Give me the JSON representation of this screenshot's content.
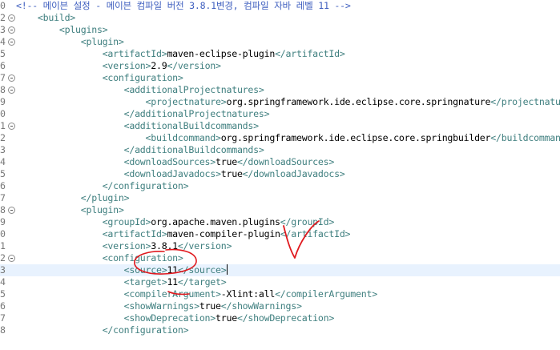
{
  "editor": {
    "lines": [
      {
        "num": "0",
        "fold": false,
        "indent": "",
        "parts": [
          {
            "c": "cmt",
            "t": "<!-- 메이븐 설정 - 메이븐 컴파일 버전 3.8.1변경, 컴파일 자바 레벨 11 -->"
          }
        ]
      },
      {
        "num": "2",
        "fold": true,
        "indent": "    ",
        "parts": [
          {
            "c": "tag",
            "t": "<build>"
          }
        ]
      },
      {
        "num": "3",
        "fold": true,
        "indent": "        ",
        "parts": [
          {
            "c": "tag",
            "t": "<plugins>"
          }
        ]
      },
      {
        "num": "4",
        "fold": true,
        "indent": "            ",
        "parts": [
          {
            "c": "tag",
            "t": "<plugin>"
          }
        ]
      },
      {
        "num": "5",
        "fold": false,
        "indent": "                ",
        "parts": [
          {
            "c": "tag",
            "t": "<artifactId>"
          },
          {
            "c": "txt",
            "t": "maven-eclipse-plugin"
          },
          {
            "c": "tag",
            "t": "</artifactId>"
          }
        ]
      },
      {
        "num": "6",
        "fold": false,
        "indent": "                ",
        "parts": [
          {
            "c": "tag",
            "t": "<version>"
          },
          {
            "c": "txt",
            "t": "2.9"
          },
          {
            "c": "tag",
            "t": "</version>"
          }
        ]
      },
      {
        "num": "7",
        "fold": true,
        "indent": "                ",
        "parts": [
          {
            "c": "tag",
            "t": "<configuration>"
          }
        ]
      },
      {
        "num": "8",
        "fold": true,
        "indent": "                    ",
        "parts": [
          {
            "c": "tag",
            "t": "<additionalProjectnatures>"
          }
        ]
      },
      {
        "num": "9",
        "fold": false,
        "indent": "                        ",
        "parts": [
          {
            "c": "tag",
            "t": "<projectnature>"
          },
          {
            "c": "txt",
            "t": "org.springframework.ide.eclipse.core.springnature"
          },
          {
            "c": "tag",
            "t": "</projectnature>"
          }
        ]
      },
      {
        "num": "0",
        "fold": false,
        "indent": "                    ",
        "parts": [
          {
            "c": "tag",
            "t": "</additionalProjectnatures>"
          }
        ]
      },
      {
        "num": "1",
        "fold": true,
        "indent": "                    ",
        "parts": [
          {
            "c": "tag",
            "t": "<additionalBuildcommands>"
          }
        ]
      },
      {
        "num": "2",
        "fold": false,
        "indent": "                        ",
        "parts": [
          {
            "c": "tag",
            "t": "<buildcommand>"
          },
          {
            "c": "txt",
            "t": "org.springframework.ide.eclipse.core.springbuilder"
          },
          {
            "c": "tag",
            "t": "</buildcommand>"
          }
        ]
      },
      {
        "num": "3",
        "fold": false,
        "indent": "                    ",
        "parts": [
          {
            "c": "tag",
            "t": "</additionalBuildcommands>"
          }
        ]
      },
      {
        "num": "4",
        "fold": false,
        "indent": "                    ",
        "parts": [
          {
            "c": "tag",
            "t": "<downloadSources>"
          },
          {
            "c": "txt",
            "t": "true"
          },
          {
            "c": "tag",
            "t": "</downloadSources>"
          }
        ]
      },
      {
        "num": "5",
        "fold": false,
        "indent": "                    ",
        "parts": [
          {
            "c": "tag",
            "t": "<downloadJavadocs>"
          },
          {
            "c": "txt",
            "t": "true"
          },
          {
            "c": "tag",
            "t": "</downloadJavadocs>"
          }
        ]
      },
      {
        "num": "6",
        "fold": false,
        "indent": "                ",
        "parts": [
          {
            "c": "tag",
            "t": "</configuration>"
          }
        ]
      },
      {
        "num": "7",
        "fold": false,
        "indent": "            ",
        "parts": [
          {
            "c": "tag",
            "t": "</plugin>"
          }
        ]
      },
      {
        "num": "8",
        "fold": true,
        "indent": "            ",
        "parts": [
          {
            "c": "tag",
            "t": "<plugin>"
          }
        ]
      },
      {
        "num": "9",
        "fold": false,
        "indent": "                ",
        "parts": [
          {
            "c": "tag",
            "t": "<groupId>"
          },
          {
            "c": "txt",
            "t": "org.apache.maven.plugins"
          },
          {
            "c": "tag",
            "t": "</groupId>"
          }
        ]
      },
      {
        "num": "0",
        "fold": false,
        "indent": "                ",
        "parts": [
          {
            "c": "tag",
            "t": "<artifactId>"
          },
          {
            "c": "txt",
            "t": "maven-compiler-plugin"
          },
          {
            "c": "tag",
            "t": "</artifactId>"
          }
        ]
      },
      {
        "num": "1",
        "fold": false,
        "indent": "                ",
        "parts": [
          {
            "c": "tag",
            "t": "<version>"
          },
          {
            "c": "txt",
            "t": "3.8.1"
          },
          {
            "c": "tag",
            "t": "</version>"
          }
        ]
      },
      {
        "num": "2",
        "fold": true,
        "indent": "                ",
        "parts": [
          {
            "c": "tag",
            "t": "<configuration>"
          }
        ]
      },
      {
        "num": "3",
        "fold": false,
        "indent": "                    ",
        "current": true,
        "parts": [
          {
            "c": "tag",
            "t": "<source>"
          },
          {
            "c": "txt",
            "t": "11"
          },
          {
            "c": "tag",
            "t": "</source>"
          }
        ]
      },
      {
        "num": "4",
        "fold": false,
        "indent": "                    ",
        "parts": [
          {
            "c": "tag",
            "t": "<target>"
          },
          {
            "c": "txt",
            "t": "11"
          },
          {
            "c": "tag",
            "t": "</target>"
          }
        ]
      },
      {
        "num": "5",
        "fold": false,
        "indent": "                    ",
        "parts": [
          {
            "c": "tag",
            "t": "<compilerArgument>"
          },
          {
            "c": "txt",
            "t": "-Xlint:all"
          },
          {
            "c": "tag",
            "t": "</compilerArgument>"
          }
        ]
      },
      {
        "num": "6",
        "fold": false,
        "indent": "                    ",
        "parts": [
          {
            "c": "tag",
            "t": "<showWarnings>"
          },
          {
            "c": "txt",
            "t": "true"
          },
          {
            "c": "tag",
            "t": "</showWarnings>"
          }
        ]
      },
      {
        "num": "7",
        "fold": false,
        "indent": "                    ",
        "parts": [
          {
            "c": "tag",
            "t": "<showDeprecation>"
          },
          {
            "c": "txt",
            "t": "true"
          },
          {
            "c": "tag",
            "t": "</showDeprecation>"
          }
        ]
      },
      {
        "num": "8",
        "fold": false,
        "indent": "                ",
        "parts": [
          {
            "c": "tag",
            "t": "</configuration>"
          }
        ]
      }
    ]
  },
  "colors": {
    "comment": "#3f5fbf",
    "tag": "#3f7f7f",
    "text": "#000000",
    "current_line": "#e8f2fe",
    "annotation": "#e0191e"
  },
  "icons": {
    "fold": "fold-collapse-icon",
    "annotation": "checkmark-annotation"
  }
}
